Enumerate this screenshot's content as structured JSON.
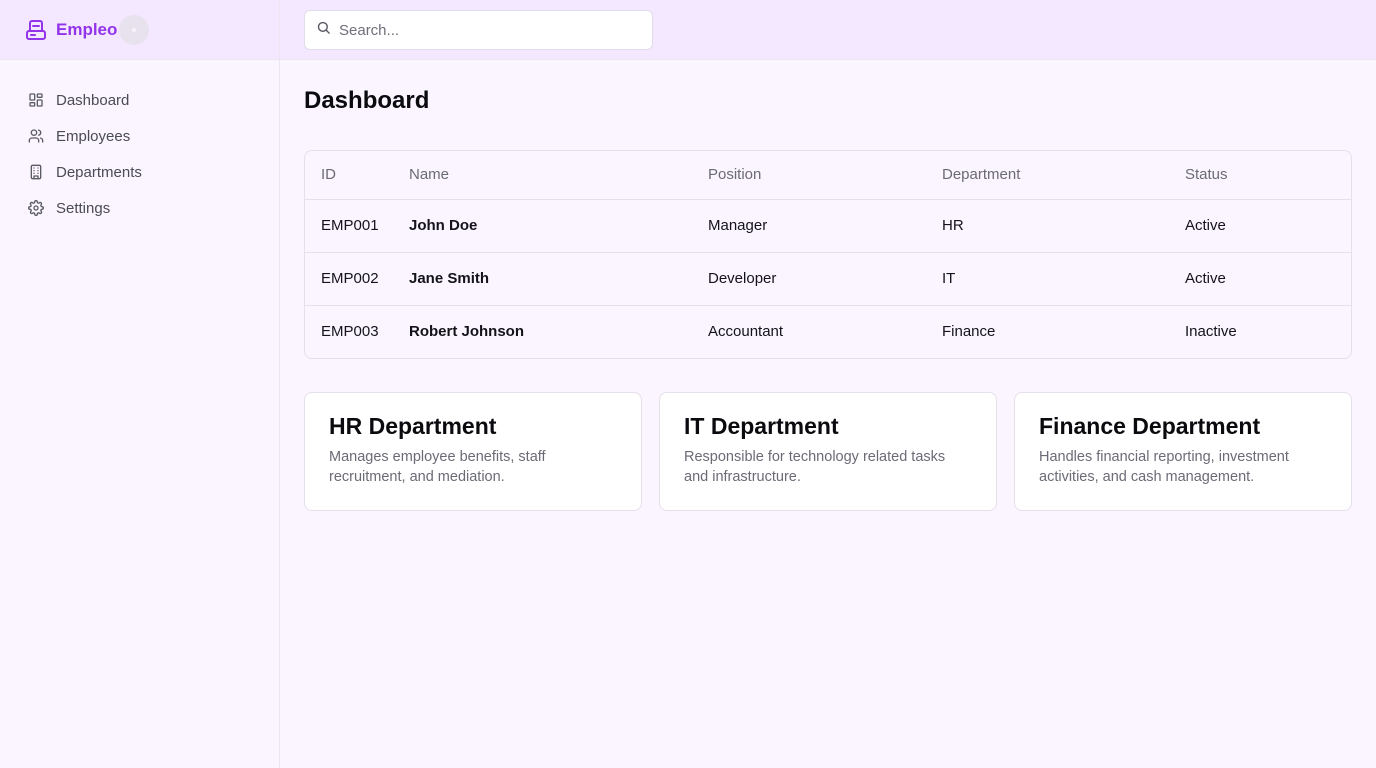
{
  "brand": {
    "name": "Empleo",
    "icon": "server-stack-icon",
    "accent": "#9333ea"
  },
  "search": {
    "placeholder": "Search...",
    "value": ""
  },
  "sidebar": {
    "items": [
      {
        "label": "Dashboard",
        "icon": "layout-dashboard-icon"
      },
      {
        "label": "Employees",
        "icon": "users-icon"
      },
      {
        "label": "Departments",
        "icon": "building-icon"
      },
      {
        "label": "Settings",
        "icon": "gear-icon"
      }
    ]
  },
  "main": {
    "title": "Dashboard",
    "table": {
      "headers": [
        "ID",
        "Name",
        "Position",
        "Department",
        "Status"
      ],
      "rows": [
        {
          "id": "EMP001",
          "name": "John Doe",
          "position": "Manager",
          "department": "HR",
          "status": "Active"
        },
        {
          "id": "EMP002",
          "name": "Jane Smith",
          "position": "Developer",
          "department": "IT",
          "status": "Active"
        },
        {
          "id": "EMP003",
          "name": "Robert Johnson",
          "position": "Accountant",
          "department": "Finance",
          "status": "Inactive"
        }
      ]
    },
    "cards": [
      {
        "title": "HR Department",
        "description": "Manages employee benefits, staff recruitment, and mediation."
      },
      {
        "title": "IT Department",
        "description": "Responsible for technology related tasks and infrastructure."
      },
      {
        "title": "Finance Department",
        "description": "Handles financial reporting, investment activities, and cash management."
      }
    ]
  }
}
